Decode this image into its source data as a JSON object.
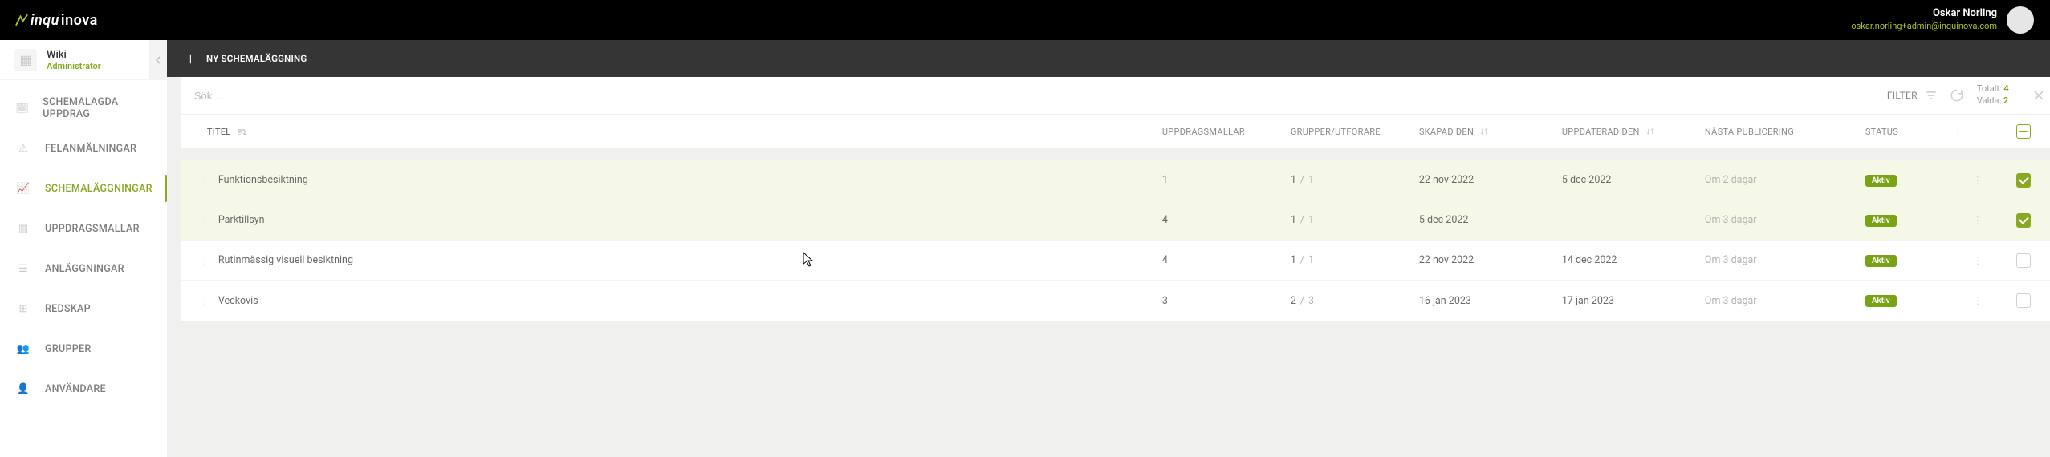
{
  "header": {
    "brand_prefix": "inqu",
    "brand_suffix": "inova",
    "user_name": "Oskar Norling",
    "user_email": "oskar.norling+admin@inquinova.com"
  },
  "sidebar": {
    "project_title": "Wiki",
    "project_role": "Administratör",
    "items": [
      {
        "label": "SCHEMALAGDA UPPDRAG",
        "icon": "🗓"
      },
      {
        "label": "FELANMÄLNINGAR",
        "icon": "⚠"
      },
      {
        "label": "SCHEMALÄGGNINGAR",
        "icon": "📈"
      },
      {
        "label": "UPPDRAGSMALLAR",
        "icon": "▥"
      },
      {
        "label": "ANLÄGGNINGAR",
        "icon": "☰"
      },
      {
        "label": "REDSKAP",
        "icon": "⊞"
      },
      {
        "label": "GRUPPER",
        "icon": "👥"
      },
      {
        "label": "ANVÄNDARE",
        "icon": "👤"
      }
    ],
    "active_index": 2
  },
  "action_bar": {
    "new_label": "NY SCHEMALÄGGNING"
  },
  "search": {
    "placeholder": "Sök…"
  },
  "filter": {
    "label": "FILTER"
  },
  "totals": {
    "total_label": "Totalt:",
    "total_val": "4",
    "selected_label": "Valda:",
    "selected_val": "2"
  },
  "columns": {
    "title": "TITEL",
    "templates": "UPPDRAGSMALLAR",
    "groups": "GRUPPER/UTFÖRARE",
    "created": "SKAPAD DEN",
    "updated": "UPPDATERAD DEN",
    "next": "NÄSTA PUBLICERING",
    "status": "STATUS"
  },
  "rows": [
    {
      "title": "Funktionsbesiktning",
      "templates": "1",
      "grp_a": "1",
      "grp_b": "1",
      "created": "22 nov 2022",
      "updated": "5 dec 2022",
      "next": "Om 2 dagar",
      "status": "Aktiv",
      "selected": true
    },
    {
      "title": "Parktillsyn",
      "templates": "4",
      "grp_a": "1",
      "grp_b": "1",
      "created": "5 dec 2022",
      "updated": "",
      "next": "Om 3 dagar",
      "status": "Aktiv",
      "selected": true
    },
    {
      "title": "Rutinmässig visuell besiktning",
      "templates": "4",
      "grp_a": "1",
      "grp_b": "1",
      "created": "22 nov 2022",
      "updated": "14 dec 2022",
      "next": "Om 3 dagar",
      "status": "Aktiv",
      "selected": false
    },
    {
      "title": "Veckovis",
      "templates": "3",
      "grp_a": "2",
      "grp_b": "3",
      "created": "16 jan 2023",
      "updated": "17 jan 2023",
      "next": "Om 3 dagar",
      "status": "Aktiv",
      "selected": false
    }
  ]
}
